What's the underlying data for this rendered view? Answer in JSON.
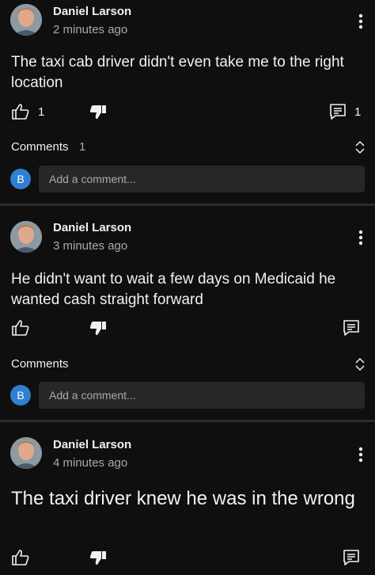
{
  "colors": {
    "background": "#0f0f0f",
    "separator": "#2b2b2b",
    "comment_input_bg": "#272727",
    "mini_avatar": "#2f80d1"
  },
  "posts": [
    {
      "author": "Daniel Larson",
      "time": "2 minutes ago",
      "text": "The taxi cab driver didn't even take me to the right location",
      "like_count": "1",
      "reply_count": "1",
      "comments_label": "Comments",
      "comments_count": "1",
      "comment_avatar_letter": "B",
      "comment_placeholder": "Add a comment..."
    },
    {
      "author": "Daniel Larson",
      "time": "3 minutes ago",
      "text": "He didn't want to wait a few days on Medicaid he wanted cash straight forward",
      "comments_label": "Comments",
      "comment_avatar_letter": "B",
      "comment_placeholder": "Add a comment..."
    },
    {
      "author": "Daniel Larson",
      "time": "4 minutes ago",
      "text": "The taxi driver knew he was in the wrong"
    }
  ],
  "icons": {
    "avatar": "avatar-photo",
    "more": "more-vertical-icon",
    "like": "thumbs-up-icon",
    "dislike": "thumbs-down-icon",
    "reply": "comment-icon",
    "expand": "expand-icon"
  }
}
